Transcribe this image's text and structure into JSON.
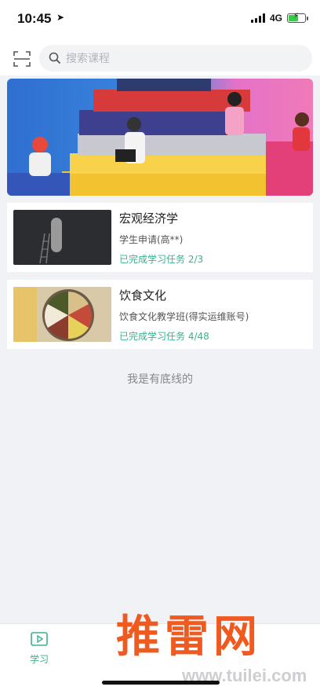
{
  "status": {
    "time": "10:45",
    "network": "4G"
  },
  "search": {
    "placeholder": "搜索课程"
  },
  "courses": [
    {
      "title": "宏观经济学",
      "subtitle": "学生申请(高**)",
      "progress": "已完成学习任务 2/3"
    },
    {
      "title": "饮食文化",
      "subtitle": "饮食文化教学班(得实运维账号)",
      "progress": "已完成学习任务 4/48"
    }
  ],
  "end_note": "我是有底线的",
  "tabbar": {
    "study_label": "学习"
  },
  "watermark": {
    "logo_text": "推雷网",
    "url": "www.tuilei.com"
  },
  "colors": {
    "accent": "#3bb08f",
    "watermark": "#f05a1f"
  }
}
